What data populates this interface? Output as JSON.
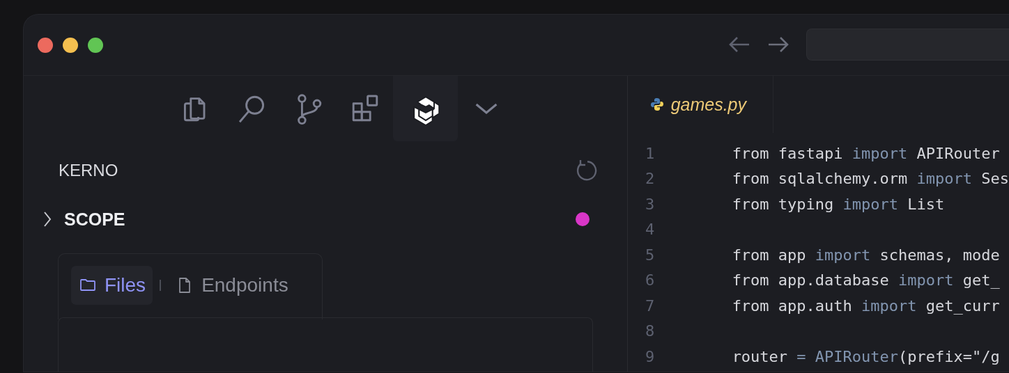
{
  "toolbar": [
    {
      "selected": false
    },
    {
      "selected": false
    },
    {
      "selected": false
    },
    {
      "selected": false
    },
    {
      "selected": true
    }
  ],
  "panel": {
    "title": "KERNO"
  },
  "scope": {
    "title": "SCOPE",
    "expanded": false
  },
  "segments": [
    {
      "label": "Files",
      "selected": true
    },
    {
      "label": "Endpoints",
      "selected": false
    }
  ],
  "editor": {
    "tabs": [
      {
        "label": "games.py",
        "selected": true
      }
    ],
    "lines": [
      {
        "number": "1",
        "tokens": [
          {
            "kind": "plain",
            "text": "from fastapi "
          },
          {
            "kind": "keyword",
            "text": "import"
          },
          {
            "kind": "plain",
            "text": " APIRouter"
          }
        ]
      },
      {
        "number": "2",
        "tokens": [
          {
            "kind": "plain",
            "text": "from sqlalchemy.orm "
          },
          {
            "kind": "keyword",
            "text": "import"
          },
          {
            "kind": "plain",
            "text": " Ses"
          }
        ]
      },
      {
        "number": "3",
        "tokens": [
          {
            "kind": "plain",
            "text": "from typing "
          },
          {
            "kind": "keyword",
            "text": "import"
          },
          {
            "kind": "plain",
            "text": " List"
          }
        ]
      },
      {
        "number": "4"
      },
      {
        "number": "5",
        "tokens": [
          {
            "kind": "plain",
            "text": "from app "
          },
          {
            "kind": "keyword",
            "text": "import"
          },
          {
            "kind": "plain",
            "text": " schemas, mode"
          }
        ]
      },
      {
        "number": "6",
        "tokens": [
          {
            "kind": "plain",
            "text": "from app.database "
          },
          {
            "kind": "keyword",
            "text": "import"
          },
          {
            "kind": "plain",
            "text": " get_"
          }
        ]
      },
      {
        "number": "7",
        "tokens": [
          {
            "kind": "plain",
            "text": "from app.auth "
          },
          {
            "kind": "keyword",
            "text": "import"
          },
          {
            "kind": "plain",
            "text": " get_curr"
          }
        ]
      },
      {
        "number": "8"
      },
      {
        "number": "9",
        "tokens": [
          {
            "kind": "plain",
            "text": "router "
          },
          {
            "kind": "keyword",
            "text": "= APIRouter"
          },
          {
            "kind": "plain",
            "text": "(prefix=\"/g"
          }
        ]
      }
    ]
  }
}
